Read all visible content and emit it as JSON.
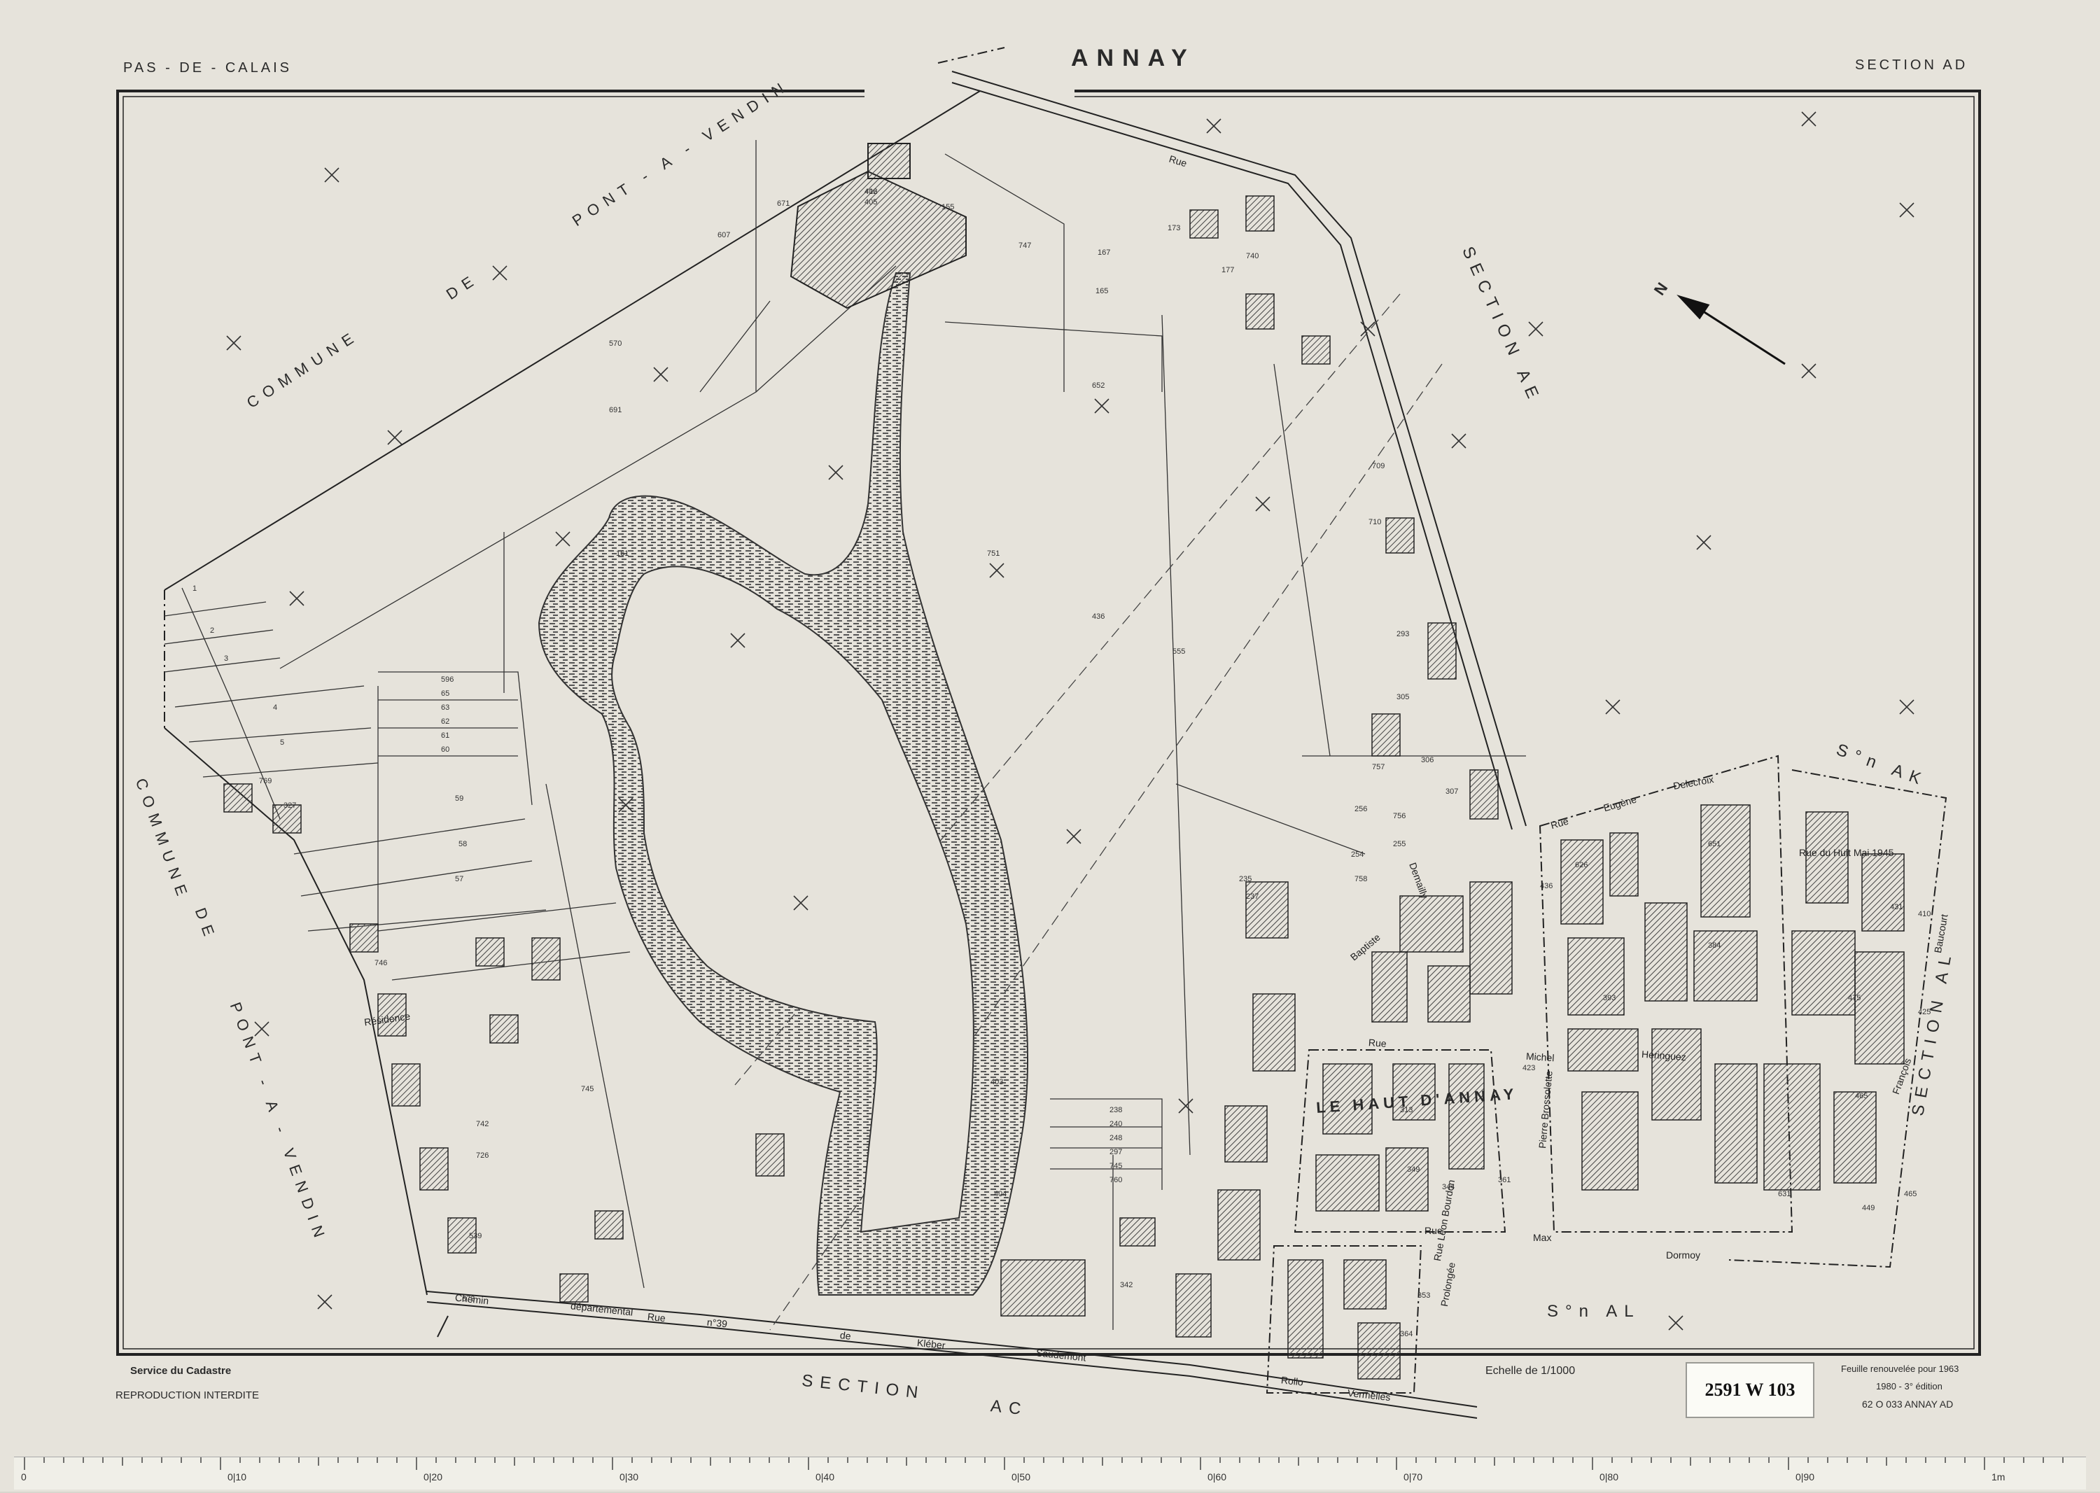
{
  "header": {
    "department": "PAS - DE - CALAIS",
    "commune_title": "ANNAY",
    "section_title": "SECTION  AD"
  },
  "commune_labels": {
    "north": [
      "COMMUNE",
      "DE",
      "PONT - A - VENDIN"
    ],
    "west": [
      "COMMUNE",
      "DE",
      "PONT - A - VENDIN"
    ]
  },
  "section_labels": {
    "ae": "SECTION     AE",
    "al": "SECTION     AL",
    "ac": [
      "SECTION",
      "AC"
    ],
    "on_ak": "S°n AK",
    "on_al": "S°n AL"
  },
  "district_label": "LE HAUT D'ANNAY",
  "streets": {
    "rue_top": "Rue",
    "residence": "Résidence",
    "chemin": "Chemin",
    "departemental": "départemental",
    "rue_bottom": "Rue",
    "n39": "n°39",
    "de": "de",
    "kleber": "Kléber",
    "saudemont": "Saudemont",
    "rollo": "Rollo",
    "vermelles": "Vermelles",
    "rue_eugene": "Rue",
    "eugene": "Eugène",
    "delecroix": "Delecroix",
    "rue_huit_mai": "Rue   du   Huit   Mai  1945",
    "rue_michel": "Rue",
    "michel": "Michel",
    "heringuez": "Héringuez",
    "rue_max": "Rue",
    "max": "Max",
    "dormoy": "Dormoy",
    "rue_leon": "Rue   Léon   Bourdon",
    "prolongee": "Prolongée",
    "demailly": "Demailly",
    "baptiste": "Baptiste",
    "pierre_brossolette": "Pierre  Brossolette",
    "francois": "François",
    "baucourt": "Baucourt"
  },
  "parcels": [
    "406",
    "405",
    "607",
    "671",
    "155",
    "747",
    "167",
    "165",
    "173",
    "177",
    "740",
    "570",
    "652",
    "691",
    "436",
    "555",
    "161",
    "751",
    "596",
    "65",
    "63",
    "62",
    "61",
    "60",
    "59",
    "58",
    "57",
    "1",
    "2",
    "3",
    "4",
    "5",
    "769",
    "327",
    "746",
    "745",
    "742",
    "726",
    "539",
    "673",
    "293",
    "305",
    "306",
    "307",
    "756",
    "255",
    "256",
    "254",
    "758",
    "757",
    "709",
    "710",
    "235",
    "237",
    "238",
    "240",
    "248",
    "297",
    "745",
    "760",
    "342",
    "403",
    "404",
    "436",
    "626",
    "651",
    "384",
    "393",
    "423",
    "313",
    "344",
    "349",
    "361",
    "353",
    "364",
    "631",
    "465",
    "475",
    "449",
    "465",
    "425",
    "431",
    "410",
    "412"
  ],
  "compass": {
    "letter": "N"
  },
  "footer": {
    "left1": "Service du Cadastre",
    "left2": "REPRODUCTION  INTERDITE",
    "scale": "Echelle de 1/1000",
    "right1": "Feuille renouvelée pour 1963",
    "right2": "1980  -  3° édition",
    "right3": "62  O  033   ANNAY   AD"
  },
  "stamp": "2591 W 103",
  "ruler": {
    "labels": [
      "0",
      "0|10",
      "0|20",
      "0|30",
      "0|40",
      "0|50",
      "0|60",
      "0|70",
      "0|80",
      "0|90",
      "1m"
    ]
  },
  "colors": {
    "paper": "#e6e3db",
    "ink": "#2a2a2a",
    "hatch": "#555555"
  }
}
